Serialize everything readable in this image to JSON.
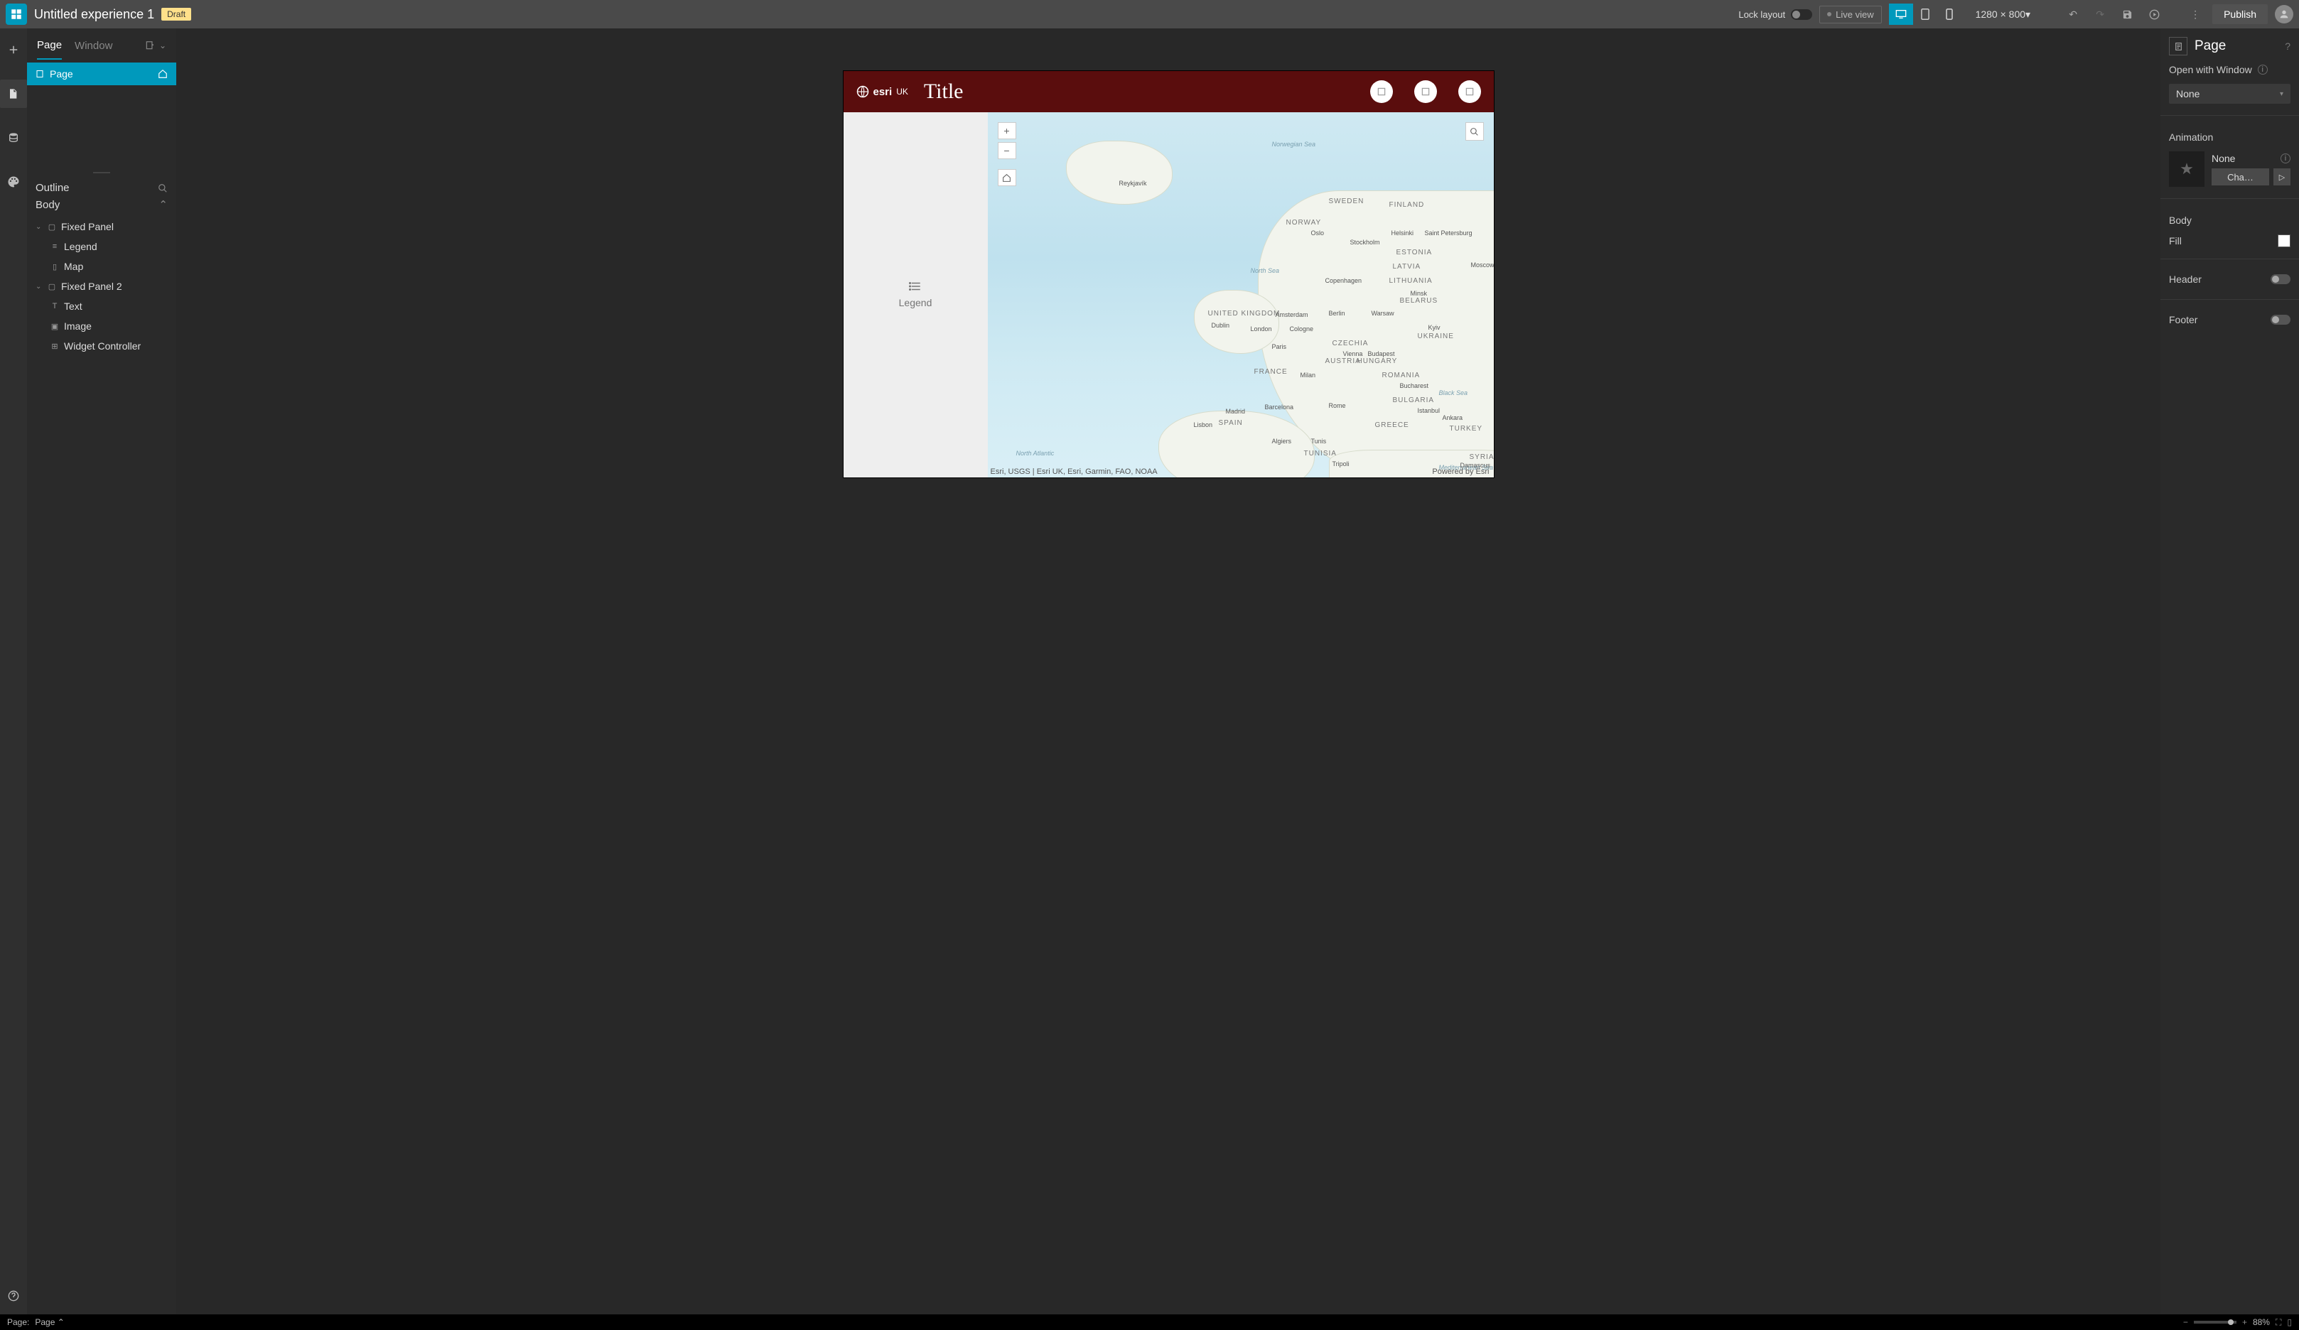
{
  "topbar": {
    "title": "Untitled experience 1",
    "badge": "Draft",
    "lock_label": "Lock layout",
    "live_label": "Live view",
    "dimensions": "1280 × 800",
    "publish": "Publish"
  },
  "leftpanel": {
    "tabs": {
      "page": "Page",
      "window": "Window"
    },
    "page_item": "Page",
    "outline": "Outline",
    "body": "Body",
    "tree": {
      "fixed_panel": "Fixed Panel",
      "legend": "Legend",
      "map": "Map",
      "fixed_panel2": "Fixed Panel 2",
      "text": "Text",
      "image": "Image",
      "widget_controller": "Widget Controller"
    }
  },
  "canvas": {
    "brand": "esri",
    "brand_suffix": "UK",
    "title": "Title",
    "legend_label": "Legend",
    "credits": "Esri, USGS | Esri UK, Esri, Garmin, FAO, NOAA",
    "powered": "Powered by Esri",
    "labels": {
      "reykjavik": "Reykjavík",
      "norwegian_sea": "Norwegian Sea",
      "north_sea": "North Sea",
      "north_atlantic": "North Atlantic",
      "mediterranean": "Mediterranean Sea",
      "black_sea": "Black Sea",
      "uk": "UNITED KINGDOM",
      "ireland_dublin": "Dublin",
      "norway": "NORWAY",
      "sweden": "SWEDEN",
      "finland": "FINLAND",
      "oslo": "Oslo",
      "stockholm": "Stockholm",
      "helsinki": "Helsinki",
      "stpete": "Saint Petersburg",
      "estonia": "ESTONIA",
      "latvia": "LATVIA",
      "lith": "LITHUANIA",
      "belarus": "BELARUS",
      "moscow": "Moscow",
      "copenhagen": "Copenhagen",
      "amsterdam": "Amsterdam",
      "berlin": "Berlin",
      "warsaw": "Warsaw",
      "minsk": "Minsk",
      "london": "London",
      "cologne": "Cologne",
      "kyiv": "Kyiv",
      "ukraine": "UKRAINE",
      "paris": "Paris",
      "czechia": "CZECHIA",
      "vienna": "Vienna",
      "austria": "AUSTRIA",
      "hungary": "HUNGARY",
      "budapest": "Budapest",
      "france": "FRANCE",
      "milan": "Milan",
      "romania": "ROMANIA",
      "bucharest": "Bucharest",
      "madrid": "Madrid",
      "barcelona": "Barcelona",
      "rome": "Rome",
      "bulgaria": "BULGARIA",
      "istanbul": "Istanbul",
      "lisbon": "Lisbon",
      "spain": "SPAIN",
      "greece": "GREECE",
      "ankara": "Ankara",
      "turkey": "TURKEY",
      "algiers": "Algiers",
      "tunis": "Tunis",
      "tunisia": "TUNISIA",
      "tripoli": "Tripoli",
      "syria": "SYRIA",
      "damascus": "Damascus"
    }
  },
  "rightpanel": {
    "title": "Page",
    "open_with": "Open with Window",
    "open_sel": "None",
    "animation": "Animation",
    "anim_value": "None",
    "change": "Cha…",
    "body": "Body",
    "fill": "Fill",
    "header": "Header",
    "footer": "Footer"
  },
  "bottombar": {
    "page_label": "Page:",
    "page_value": "Page",
    "zoom": "88%"
  }
}
